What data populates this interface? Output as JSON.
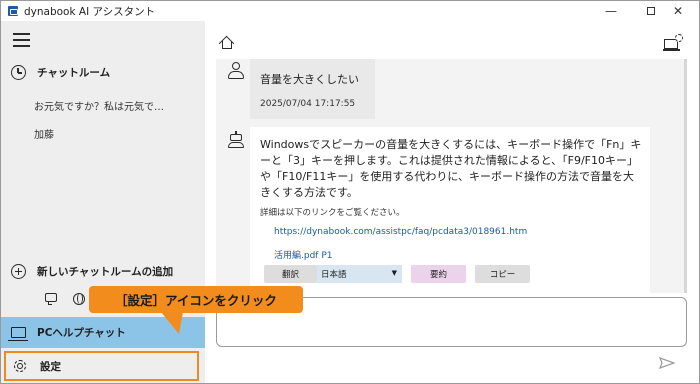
{
  "window": {
    "title": "dynabook AI アシスタント",
    "minimize": "—",
    "close": "✕"
  },
  "sidebar": {
    "history_label": "チャットルーム",
    "chat_items": [
      "お元気ですか？私は元気で…",
      "加藤"
    ],
    "new_chat_label": "新しいチャットルームの追加",
    "pc_help_label": "PCヘルプチャット",
    "settings_label": "設定"
  },
  "callout": {
    "text": "［設定］アイコンをクリック"
  },
  "chat": {
    "user_message": "音量を大きくしたい",
    "user_timestamp": "2025/07/04 17:17:55",
    "bot_message": "Windowsでスピーカーの音量を大きくするには、キーボード操作で「Fn」キーと「3」キーを押します。これは提供された情報によると、「F9/F10キー」や「F10/F11キー」を使用する代わりに、キーボード操作の方法で音量を大きくする方法です。",
    "detail_label": "詳細は以下のリンクをご覧ください。",
    "links": [
      "https://dynabook.com/assistpc/faq/pcdata3/018961.htm",
      "活用編.pdf P1"
    ],
    "actions": {
      "translate": "翻訳",
      "language": "日本語",
      "summary": "要約",
      "copy": "コピー"
    }
  },
  "colors": {
    "accent_orange": "#f28c1c",
    "pc_help_highlight": "#8cc4e8",
    "link": "#1e5aa8",
    "summary_button": "#ecd3ec",
    "language_select": "#d8e6f2"
  }
}
